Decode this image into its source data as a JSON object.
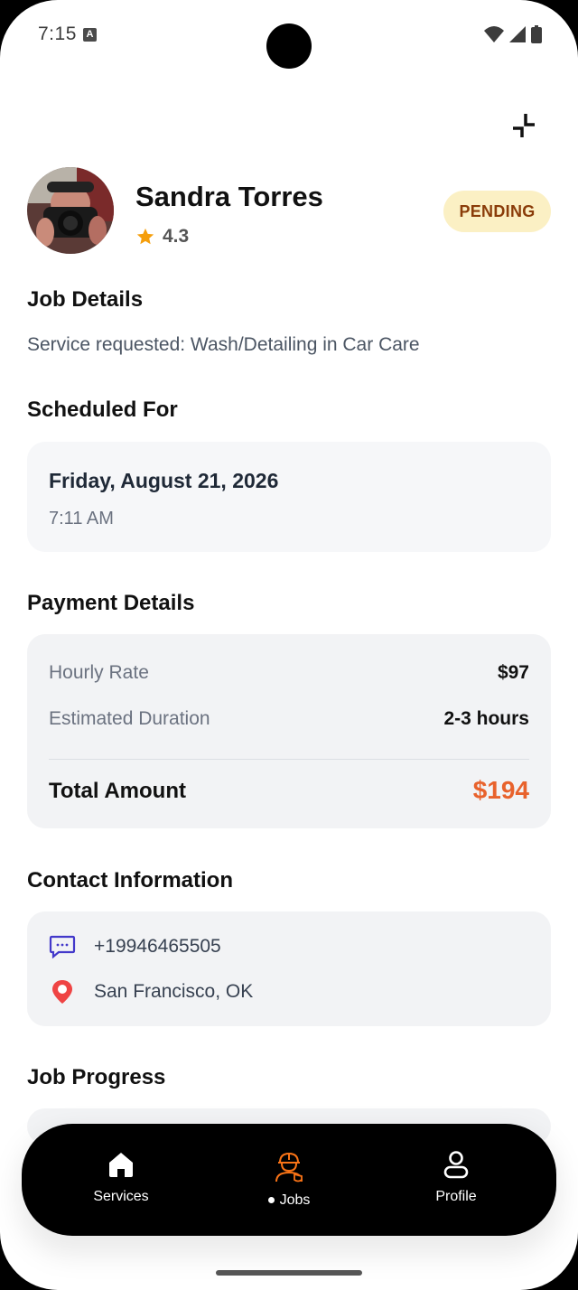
{
  "status_bar": {
    "time": "7:15",
    "app_icon_letter": "A"
  },
  "profile": {
    "name": "Sandra Torres",
    "rating": "4.3",
    "status": "PENDING"
  },
  "job_details": {
    "title": "Job Details",
    "description": "Service requested: Wash/Detailing in Car Care"
  },
  "schedule": {
    "title": "Scheduled For",
    "date": "Friday, August 21, 2026",
    "time": "7:11 AM"
  },
  "payment": {
    "title": "Payment Details",
    "hourly_rate_label": "Hourly Rate",
    "hourly_rate_value": "$97",
    "duration_label": "Estimated Duration",
    "duration_value": "2-3 hours",
    "total_label": "Total Amount",
    "total_value": "$194"
  },
  "contact": {
    "title": "Contact Information",
    "phone": "+19946465505",
    "location": "San Francisco, OK"
  },
  "progress": {
    "title": "Job Progress"
  },
  "nav": {
    "services": "Services",
    "jobs": "Jobs",
    "profile": "Profile"
  },
  "colors": {
    "accent": "#e8622c",
    "badge_bg": "#fbf0c4",
    "badge_text": "#8a3c09",
    "star": "#f59e0b",
    "chat_icon": "#4338ca",
    "pin_icon": "#ef4444",
    "nav_active": "#f97316"
  },
  "icons": [
    "collapse-icon",
    "star-icon",
    "chat-icon",
    "location-pin-icon",
    "home-icon",
    "worker-icon",
    "user-icon"
  ]
}
